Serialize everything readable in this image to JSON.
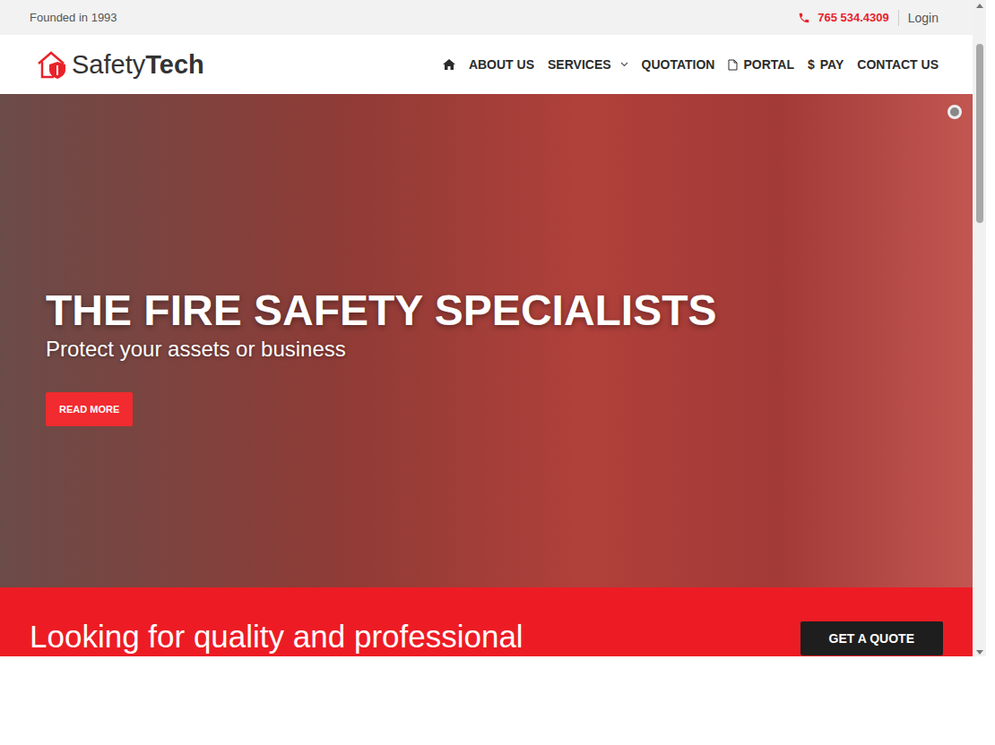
{
  "topbar": {
    "founded": "Founded in 1993",
    "phone": "765 534.4309",
    "login": "Login"
  },
  "logo": {
    "prefix": "Safety",
    "suffix": "Tech"
  },
  "nav": [
    {
      "label": "",
      "kind": "home",
      "selected": false
    },
    {
      "label": "ABOUT US",
      "kind": "text",
      "selected": false
    },
    {
      "label": "SERVICES",
      "kind": "dropdown",
      "selected": false
    },
    {
      "label": "QUOTATION",
      "kind": "text",
      "selected": false
    },
    {
      "label": "PORTAL",
      "kind": "document",
      "selected": false
    },
    {
      "label": "PAY",
      "kind": "glyph",
      "glyph": "$",
      "selected": false
    },
    {
      "label": "CONTACT US",
      "kind": "text",
      "selected": false
    }
  ],
  "hero": {
    "title": "THE FIRE SAFETY SPECIALISTS",
    "subtitle": "Protect your assets or business",
    "button": "READ MORE",
    "slides": [
      {
        "selected": true
      }
    ]
  },
  "cta": {
    "text": "Looking for quality and professional",
    "button": "GET A QUOTE"
  }
}
